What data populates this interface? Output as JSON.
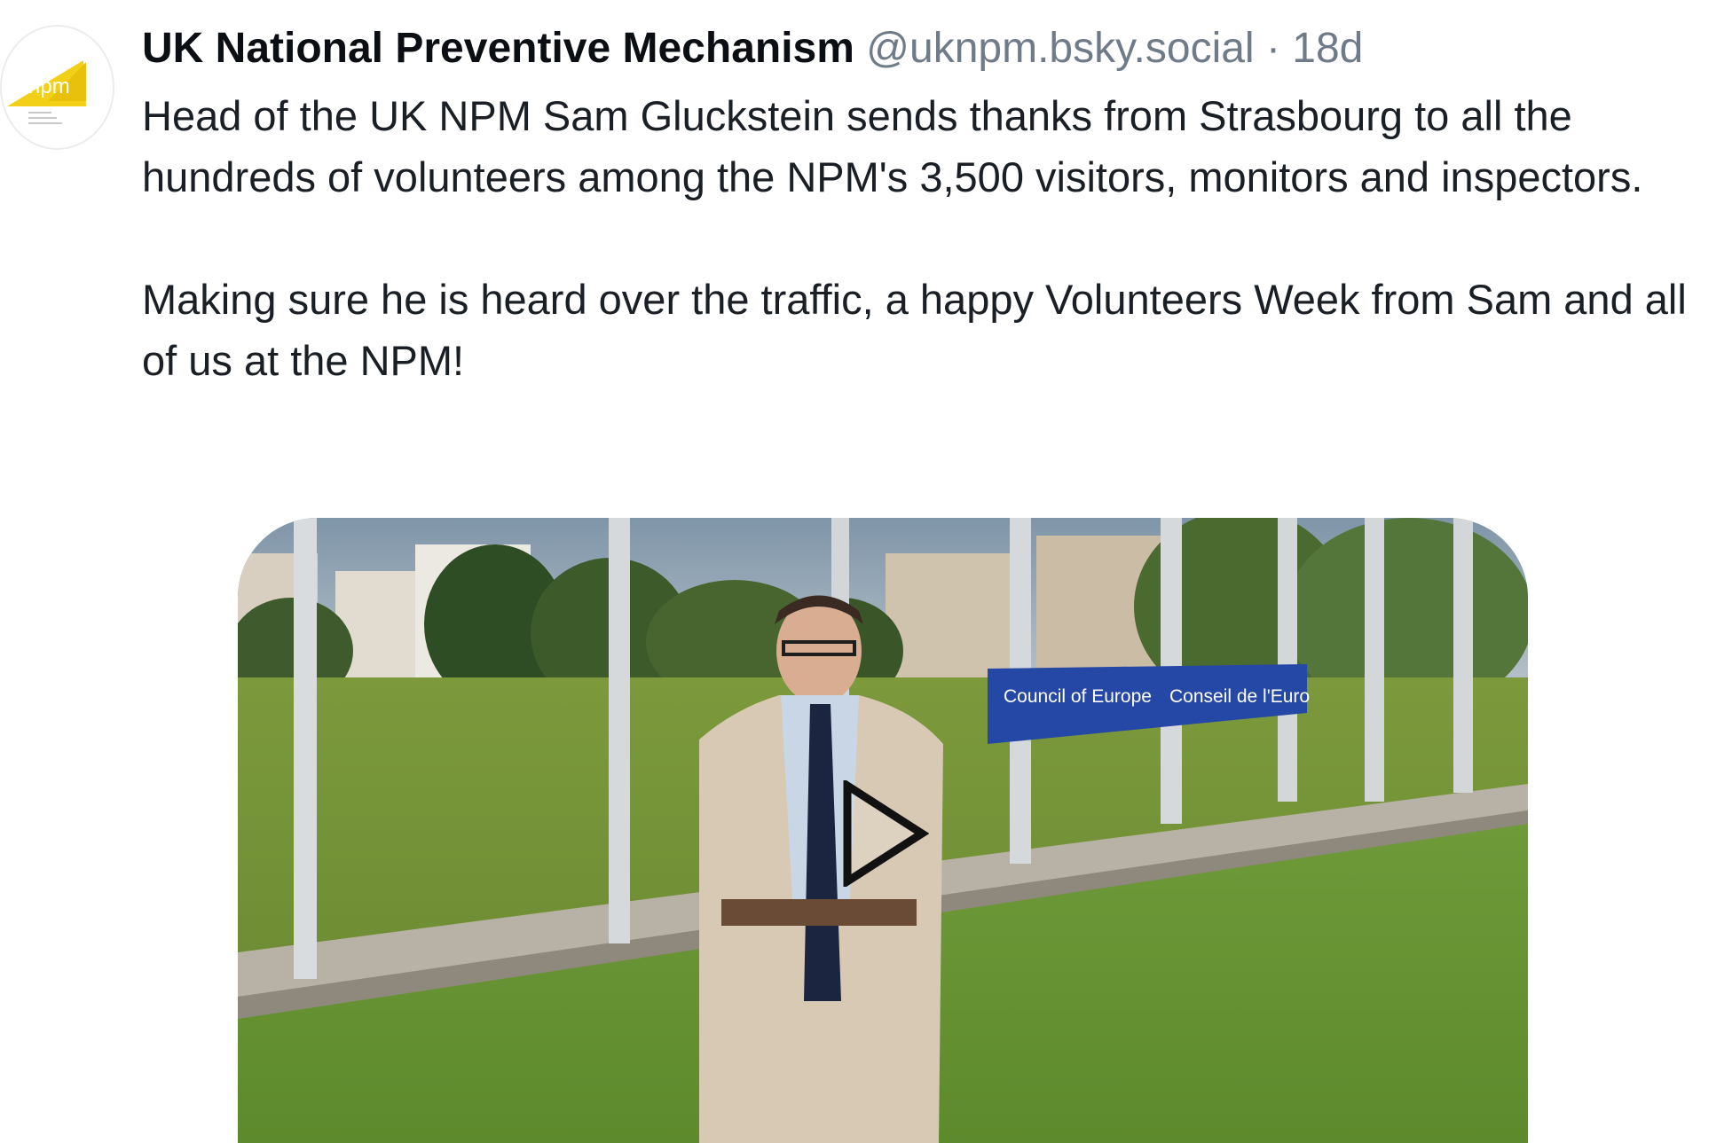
{
  "post": {
    "author_name": "UK National Preventive Mechanism",
    "handle": "@uknpm.bsky.social",
    "separator": "·",
    "time": "18d",
    "avatar_logo_text": "npm",
    "paragraphs": [
      "Head of the UK NPM Sam Gluckstein sends thanks from Strasbourg to all the hundreds of volunteers among the NPM's 3,500 visitors, monitors and inspectors.",
      "Making sure he is heard over the traffic, a happy Volunteers Week from Sam and all of us at the NPM!"
    ]
  },
  "video": {
    "sign_left_text": "Council of Europe",
    "sign_right_text": "Conseil de l'Euro",
    "play_icon": "play-icon"
  },
  "colors": {
    "text": "#0b0f14",
    "muted": "#6f7b88",
    "logo_yellow": "#f2d017",
    "sign_blue": "#2548a6"
  }
}
